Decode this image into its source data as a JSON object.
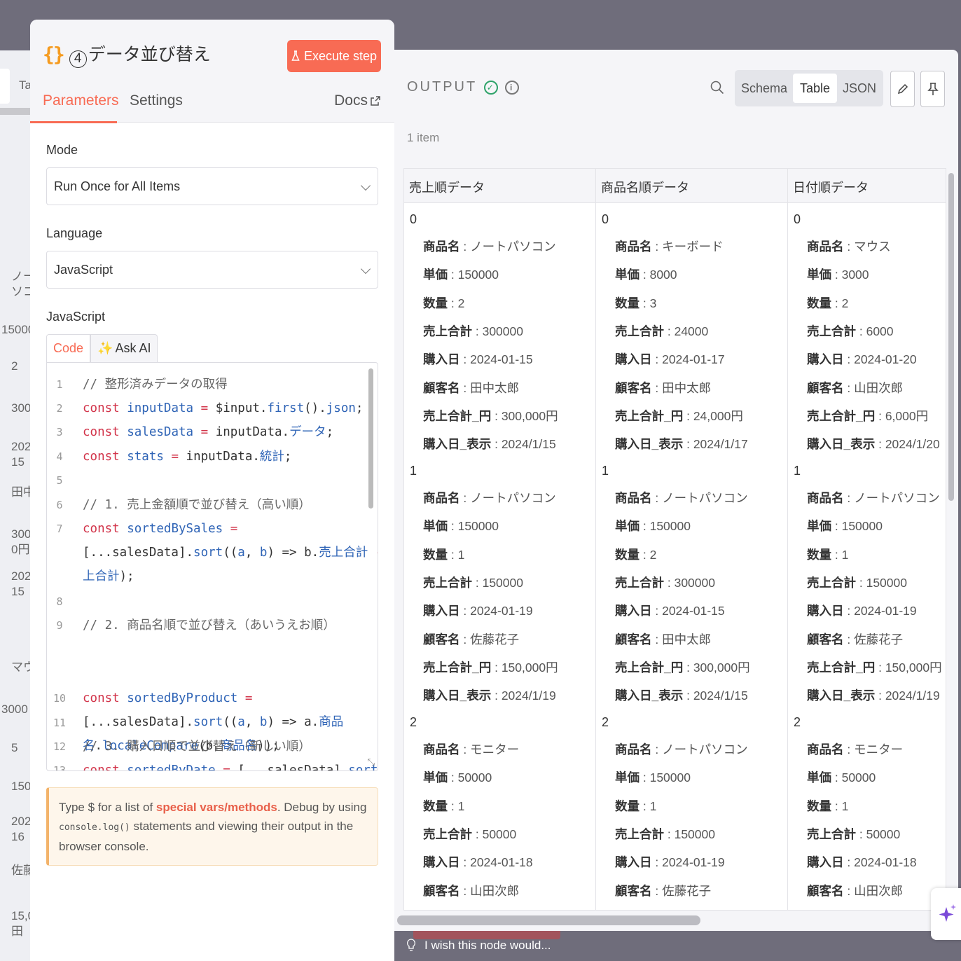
{
  "background": {
    "tab_text": "Ta",
    "fragments": [
      "ノー\nソコ",
      "150000",
      "2",
      "300",
      "202\n15",
      "田中",
      "300\n0円",
      "202\n15",
      "マウ",
      "3000",
      "5",
      "150",
      "202\n16",
      "佐藤",
      "15,0\n田"
    ]
  },
  "node": {
    "number": "4",
    "title": "データ並び替え",
    "execute_label": "Execute step",
    "tabs": {
      "parameters": "Parameters",
      "settings": "Settings",
      "docs": "Docs"
    }
  },
  "params": {
    "mode_label": "Mode",
    "mode_value": "Run Once for All Items",
    "language_label": "Language",
    "language_value": "JavaScript",
    "code_label": "JavaScript",
    "code_tab": "Code",
    "ask_ai_tab": "Ask AI"
  },
  "code_lines": [
    {
      "n": "1",
      "html": "<span class=\"c-cm\">// 整形済みデータの取得</span>"
    },
    {
      "n": "2",
      "html": "<span class=\"c-kw\">const</span> <span class=\"c-vr\">inputData</span> <span class=\"c-kw\">=</span> $input.<span class=\"c-vr\">first</span>().<span class=\"c-vr\">json</span>;"
    },
    {
      "n": "3",
      "html": "<span class=\"c-kw\">const</span> <span class=\"c-vr\">salesData</span> <span class=\"c-kw\">=</span> inputData.<span class=\"c-vr\">データ</span>;"
    },
    {
      "n": "4",
      "html": "<span class=\"c-kw\">const</span> <span class=\"c-vr\">stats</span> <span class=\"c-kw\">=</span> inputData.<span class=\"c-vr\">統計</span>;"
    },
    {
      "n": "5",
      "html": ""
    },
    {
      "n": "6",
      "html": "<span class=\"c-cm\">// 1. 売上金額順で並び替え（高い順）</span>"
    },
    {
      "n": "7",
      "html": "<span class=\"c-kw\">const</span> <span class=\"c-vr\">sortedBySales</span> <span class=\"c-kw\">=</span>\n[...salesData].<span class=\"c-vr\">sort</span>((<span class=\"c-vr\">a</span>, <span class=\"c-vr\">b</span>) => b.<span class=\"c-vr\">売上合計</span> <span class=\"c-kw\">-</span> a.<span class=\"c-vr\">売</span>\n<span class=\"c-vr\">上合計</span>);"
    },
    {
      "n": "8",
      "html": ""
    },
    {
      "n": "9",
      "html": "<span class=\"c-cm\">// 2. 商品名順で並び替え（あいうえお順）</span>"
    },
    {
      "n": "10",
      "html": "<span class=\"c-kw\">const</span> <span class=\"c-vr\">sortedByProduct</span> <span class=\"c-kw\">=</span>\n[...salesData].<span class=\"c-vr\">sort</span>((<span class=\"c-vr\">a</span>, <span class=\"c-vr\">b</span>) => a.<span class=\"c-vr\">商品</span>\n<span class=\"c-vr\">名</span>.<span class=\"c-vr\">localeCompare</span>(b.<span class=\"c-vr\">商品名</span>));"
    },
    {
      "n": "11",
      "html": ""
    },
    {
      "n": "12",
      "html": "<span class=\"c-cm\">// 3. 購入日順で並び替え（新しい順）</span>"
    },
    {
      "n": "13",
      "html": "<span class=\"c-kw\">const</span> <span class=\"c-vr\">sortedByDate</span> <span class=\"c-kw\">=</span> [...salesData].<span class=\"c-vr\">sort</span>((<span class=\"c-vr\">a</span>"
    }
  ],
  "hint": {
    "p1": "Type $ for a list of ",
    "link": "special vars/methods",
    "p2": ". Debug by using ",
    "code": "console.log()",
    "p3": " statements and viewing their output in the browser console."
  },
  "output": {
    "label": "OUTPUT",
    "views": [
      "Schema",
      "Table",
      "JSON"
    ],
    "active_view": "Table",
    "item_count": "1 item",
    "columns": [
      {
        "header": "売上順データ",
        "records": [
          {
            "index": "0",
            "fields": [
              [
                "商品名",
                "ノートパソコン"
              ],
              [
                "単価",
                "150000"
              ],
              [
                "数量",
                "2"
              ],
              [
                "売上合計",
                "300000"
              ],
              [
                "購入日",
                "2024-01-15"
              ],
              [
                "顧客名",
                "田中太郎"
              ],
              [
                "売上合計_円",
                "300,000円"
              ],
              [
                "購入日_表示",
                "2024/1/15"
              ]
            ]
          },
          {
            "index": "1",
            "fields": [
              [
                "商品名",
                "ノートパソコン"
              ],
              [
                "単価",
                "150000"
              ],
              [
                "数量",
                "1"
              ],
              [
                "売上合計",
                "150000"
              ],
              [
                "購入日",
                "2024-01-19"
              ],
              [
                "顧客名",
                "佐藤花子"
              ],
              [
                "売上合計_円",
                "150,000円"
              ],
              [
                "購入日_表示",
                "2024/1/19"
              ]
            ]
          },
          {
            "index": "2",
            "fields": [
              [
                "商品名",
                "モニター"
              ],
              [
                "単価",
                "50000"
              ],
              [
                "数量",
                "1"
              ],
              [
                "売上合計",
                "50000"
              ],
              [
                "購入日",
                "2024-01-18"
              ],
              [
                "顧客名",
                "山田次郎"
              ]
            ]
          }
        ]
      },
      {
        "header": "商品名順データ",
        "records": [
          {
            "index": "0",
            "fields": [
              [
                "商品名",
                "キーボード"
              ],
              [
                "単価",
                "8000"
              ],
              [
                "数量",
                "3"
              ],
              [
                "売上合計",
                "24000"
              ],
              [
                "購入日",
                "2024-01-17"
              ],
              [
                "顧客名",
                "田中太郎"
              ],
              [
                "売上合計_円",
                "24,000円"
              ],
              [
                "購入日_表示",
                "2024/1/17"
              ]
            ]
          },
          {
            "index": "1",
            "fields": [
              [
                "商品名",
                "ノートパソコン"
              ],
              [
                "単価",
                "150000"
              ],
              [
                "数量",
                "2"
              ],
              [
                "売上合計",
                "300000"
              ],
              [
                "購入日",
                "2024-01-15"
              ],
              [
                "顧客名",
                "田中太郎"
              ],
              [
                "売上合計_円",
                "300,000円"
              ],
              [
                "購入日_表示",
                "2024/1/15"
              ]
            ]
          },
          {
            "index": "2",
            "fields": [
              [
                "商品名",
                "ノートパソコン"
              ],
              [
                "単価",
                "150000"
              ],
              [
                "数量",
                "1"
              ],
              [
                "売上合計",
                "150000"
              ],
              [
                "購入日",
                "2024-01-19"
              ],
              [
                "顧客名",
                "佐藤花子"
              ]
            ]
          }
        ]
      },
      {
        "header": "日付順データ",
        "records": [
          {
            "index": "0",
            "fields": [
              [
                "商品名",
                "マウス"
              ],
              [
                "単価",
                "3000"
              ],
              [
                "数量",
                "2"
              ],
              [
                "売上合計",
                "6000"
              ],
              [
                "購入日",
                "2024-01-20"
              ],
              [
                "顧客名",
                "山田次郎"
              ],
              [
                "売上合計_円",
                "6,000円"
              ],
              [
                "購入日_表示",
                "2024/1/20"
              ]
            ]
          },
          {
            "index": "1",
            "fields": [
              [
                "商品名",
                "ノートパソコン"
              ],
              [
                "単価",
                "150000"
              ],
              [
                "数量",
                "1"
              ],
              [
                "売上合計",
                "150000"
              ],
              [
                "購入日",
                "2024-01-19"
              ],
              [
                "顧客名",
                "佐藤花子"
              ],
              [
                "売上合計_円",
                "150,000円"
              ],
              [
                "購入日_表示",
                "2024/1/19"
              ]
            ]
          },
          {
            "index": "2",
            "fields": [
              [
                "商品名",
                "モニター"
              ],
              [
                "単価",
                "50000"
              ],
              [
                "数量",
                "1"
              ],
              [
                "売上合計",
                "50000"
              ],
              [
                "購入日",
                "2024-01-18"
              ],
              [
                "顧客名",
                "山田次郎"
              ]
            ]
          }
        ]
      }
    ]
  },
  "footer": {
    "wish_text": "I wish this node would..."
  },
  "colors": {
    "accent": "#f86b54",
    "success": "#2fa36a",
    "keyword": "#d2344a",
    "variable": "#2f64b6"
  },
  "icons": [
    "braces-icon",
    "flask-icon",
    "external-link-icon",
    "chevron-down-icon",
    "sparkle-icon",
    "check-circle-icon",
    "info-icon",
    "search-icon",
    "pencil-icon",
    "pin-icon",
    "lightbulb-icon",
    "assistant-sparkle-icon"
  ]
}
